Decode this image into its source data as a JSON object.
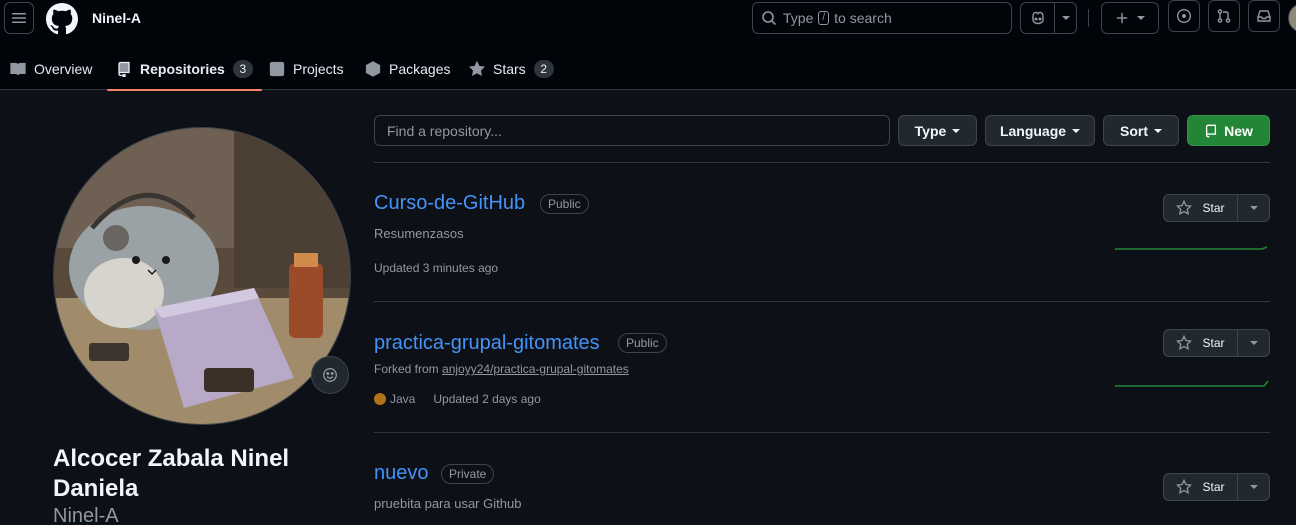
{
  "header": {
    "owner": "Ninel-A",
    "search_prefix": "Type",
    "search_key": "/",
    "search_suffix": "to search"
  },
  "profile_nav": [
    {
      "label": "Overview",
      "icon": "book-icon",
      "count": null
    },
    {
      "label": "Repositories",
      "icon": "repo-icon",
      "count": "3"
    },
    {
      "label": "Projects",
      "icon": "table-icon",
      "count": null
    },
    {
      "label": "Packages",
      "icon": "package-icon",
      "count": null
    },
    {
      "label": "Stars",
      "icon": "star-icon",
      "count": "2"
    }
  ],
  "profile": {
    "full_name": "Alcocer Zabala Ninel Daniela",
    "login": "Ninel-A"
  },
  "filters": {
    "find_placeholder": "Find a repository...",
    "type_label": "Type",
    "language_label": "Language",
    "sort_label": "Sort",
    "new_label": "New"
  },
  "repos": [
    {
      "name": "Curso-de-GitHub",
      "visibility": "Public",
      "description": "Resumenzasos",
      "forked_from": null,
      "language": null,
      "updated": "Updated 3 minutes ago",
      "star_label": "Star"
    },
    {
      "name": "practica-grupal-gitomates",
      "visibility": "Public",
      "description": null,
      "forked_prefix": "Forked from",
      "forked_from": "anjoyy24/practica-grupal-gitomates",
      "language": "Java",
      "language_color": "#b07219",
      "updated": "Updated 2 days ago",
      "star_label": "Star"
    },
    {
      "name": "nuevo",
      "visibility": "Private",
      "description": "pruebita para usar Github",
      "star_label": "Star"
    }
  ],
  "colors": {
    "accent_underline": "#f78166",
    "link": "#4493f8",
    "new_button": "#238636",
    "spark_line": "#238636"
  }
}
